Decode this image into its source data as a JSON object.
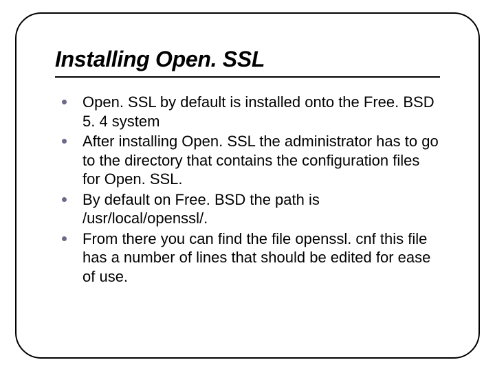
{
  "title": "Installing Open. SSL",
  "bullets": [
    "Open. SSL by default is installed onto the Free. BSD 5. 4 system",
    "After installing Open. SSL the administrator has to go to the directory that contains the configuration files for Open. SSL.",
    "By default on Free. BSD the path is /usr/local/openssl/.",
    "From there you can find the file openssl. cnf this file has a number of lines that should be edited for ease of use."
  ]
}
